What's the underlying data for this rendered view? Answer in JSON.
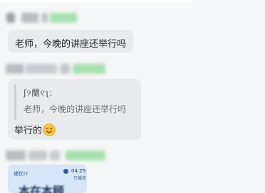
{
  "messages": [
    {
      "text": "老师，今晚的讲座还举行吗"
    },
    {
      "quote": {
        "sender": "ʃ୨蘭୧ʅ:",
        "text": "老师，今晚的讲座还举行吗"
      },
      "reply": "举行的",
      "emoji": "smiling-face-emoji"
    },
    {
      "image_preview": {
        "app_label": "補优IY",
        "time": "04:25",
        "subtext": "已播放",
        "headline": "本在本顾"
      }
    }
  ],
  "colors": {
    "background": "#f5f6f7",
    "bubble": "#e9eaec",
    "quote_bar": "#c9ccd1",
    "name_blur_gray": "#b9bcc1",
    "name_blur_green": "#a8e0b0",
    "image_card": "#d6e5f7"
  }
}
